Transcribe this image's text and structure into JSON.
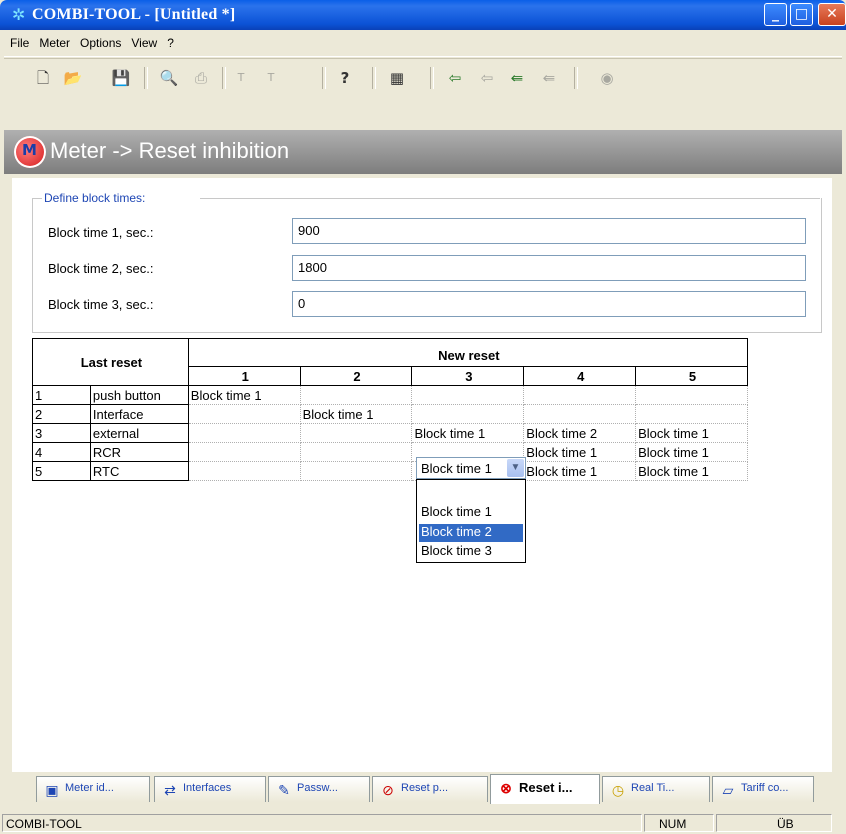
{
  "window": {
    "title": "COMBI-TOOL - [Untitled *]"
  },
  "menu": [
    "File",
    "Meter",
    "Options",
    "View",
    "?"
  ],
  "header": {
    "title": "Meter -> Reset inhibition"
  },
  "block_times": {
    "group_label": "Define block times:",
    "fields": [
      {
        "label": "Block time 1, sec.:",
        "value": "900"
      },
      {
        "label": "Block time 2, sec.:",
        "value": "1800"
      },
      {
        "label": "Block time 3, sec.:",
        "value": "0"
      }
    ]
  },
  "grid": {
    "last_reset_header": "Last reset",
    "new_reset_header": "New reset",
    "columns": [
      "1",
      "2",
      "3",
      "4",
      "5"
    ],
    "rows": [
      {
        "num": "1",
        "name": "push button",
        "cells": [
          "Block time 1",
          "",
          "",
          "",
          ""
        ]
      },
      {
        "num": "2",
        "name": "Interface",
        "cells": [
          "",
          "Block time 1",
          "",
          "",
          ""
        ]
      },
      {
        "num": "3",
        "name": "external",
        "cells": [
          "",
          "",
          "Block time 1",
          "Block time 2",
          "Block time 1"
        ]
      },
      {
        "num": "4",
        "name": "RCR",
        "cells": [
          "",
          "",
          "",
          "Block time 1",
          "Block time 1"
        ]
      },
      {
        "num": "5",
        "name": "RTC",
        "cells": [
          "",
          "",
          "",
          "Block time 1",
          "Block time 1"
        ]
      }
    ],
    "dropdown": {
      "value": "Block time 1",
      "options": [
        "",
        "Block time 1",
        "Block time 2",
        "Block time 3"
      ],
      "selected": "Block time 2"
    }
  },
  "tabs": [
    {
      "label": "Meter id...",
      "icon": "meter-id-icon"
    },
    {
      "label": "Interfaces",
      "icon": "interfaces-icon"
    },
    {
      "label": "Passw...",
      "icon": "password-icon"
    },
    {
      "label": "Reset p...",
      "icon": "reset-p-icon"
    },
    {
      "label": "Reset i...",
      "icon": "reset-inhibition-icon",
      "active": true
    },
    {
      "label": "Real Ti...",
      "icon": "clock-icon"
    },
    {
      "label": "Tariff co...",
      "icon": "tariff-icon"
    }
  ],
  "status": {
    "app": "COMBI-TOOL",
    "num": "NUM",
    "ub": "ÜB"
  }
}
